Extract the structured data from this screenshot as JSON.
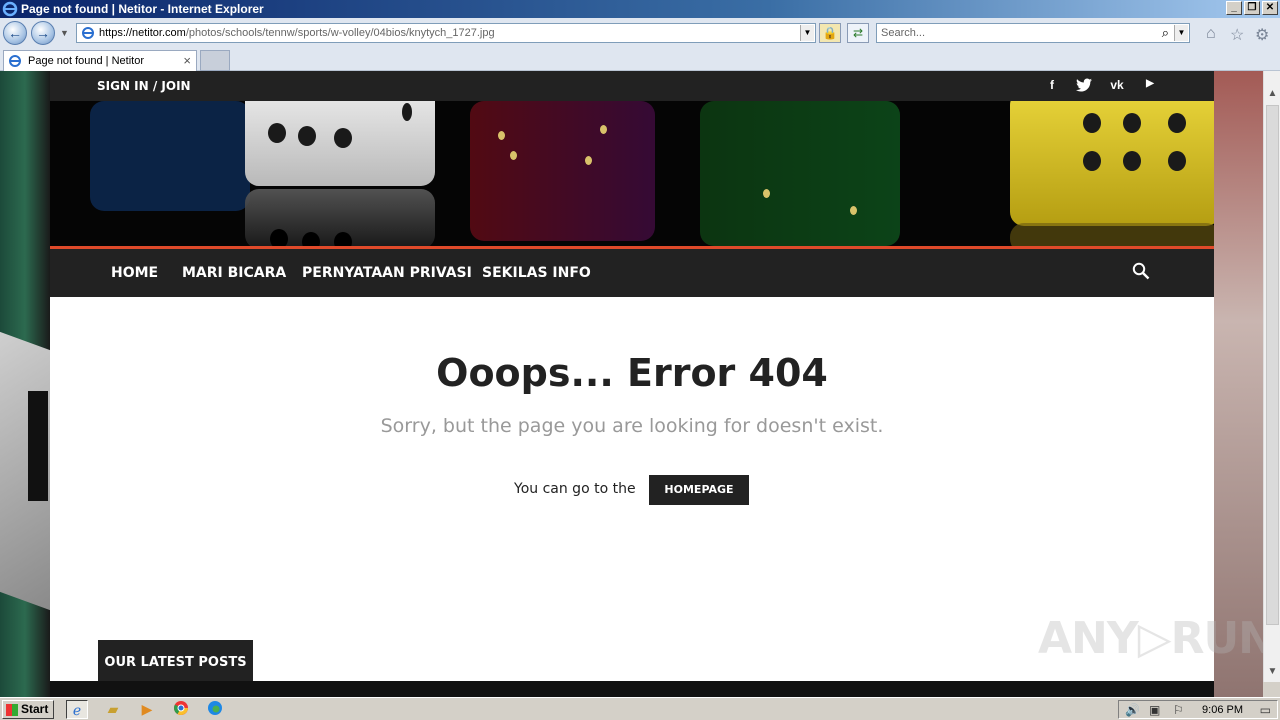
{
  "browser": {
    "window_title": "Page not found | Netitor - Internet Explorer",
    "url_host": "https://netitor.com",
    "url_path": "/photos/schools/tennw/sports/w-volley/04bios/knytych_1727.jpg",
    "search_placeholder": "Search...",
    "tab_title": "Page not found | Netitor"
  },
  "site": {
    "signin_label": "SIGN IN / JOIN",
    "social": [
      {
        "name": "facebook-icon",
        "glyph": "f"
      },
      {
        "name": "twitter-icon",
        "glyph": "🐦"
      },
      {
        "name": "vk-icon",
        "glyph": "vk"
      },
      {
        "name": "youtube-icon",
        "glyph": "▶"
      }
    ],
    "nav": [
      "HOME",
      "MARI BICARA",
      "PERNYATAAN PRIVASI",
      "SEKILAS INFO"
    ],
    "error_title": "Ooops... Error 404",
    "error_subtitle": "Sorry, but the page you are looking for doesn't exist.",
    "go_text": "You can go to the",
    "homepage_button": "HOMEPAGE",
    "latest_posts": "OUR LATEST POSTS",
    "accent_color": "#e04a2a"
  },
  "watermark": "ANY▷RUN",
  "taskbar": {
    "start_label": "Start",
    "clock": "9:06 PM"
  }
}
